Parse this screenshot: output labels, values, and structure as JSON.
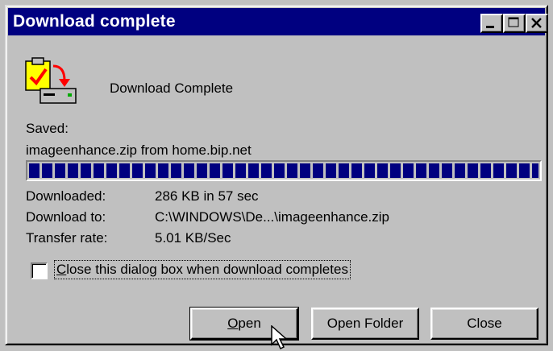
{
  "window": {
    "title": "Download complete"
  },
  "header": {
    "message": "Download Complete"
  },
  "saved": {
    "label": "Saved:",
    "item": "imageenhance.zip from home.bip.net"
  },
  "progress": {
    "percent": 100
  },
  "details": [
    {
      "label": "Downloaded:",
      "value": "286 KB in 57 sec"
    },
    {
      "label": "Download to:",
      "value": "C:\\WINDOWS\\De...\\imageenhance.zip"
    },
    {
      "label": "Transfer rate:",
      "value": "5.01 KB/Sec"
    }
  ],
  "close_checkbox": {
    "label": "Close this dialog box when download completes",
    "checked": false
  },
  "buttons": {
    "open": "Open",
    "open_folder": "Open Folder",
    "close": "Close"
  },
  "icons": {
    "title_buttons": [
      "minimize-icon",
      "maximize-icon",
      "close-icon"
    ],
    "main": "download-complete-icon",
    "pointer": "arrow-cursor-icon"
  },
  "colors": {
    "titlebar": "#000080",
    "progress": "#000080",
    "face": "#c0c0c0"
  }
}
